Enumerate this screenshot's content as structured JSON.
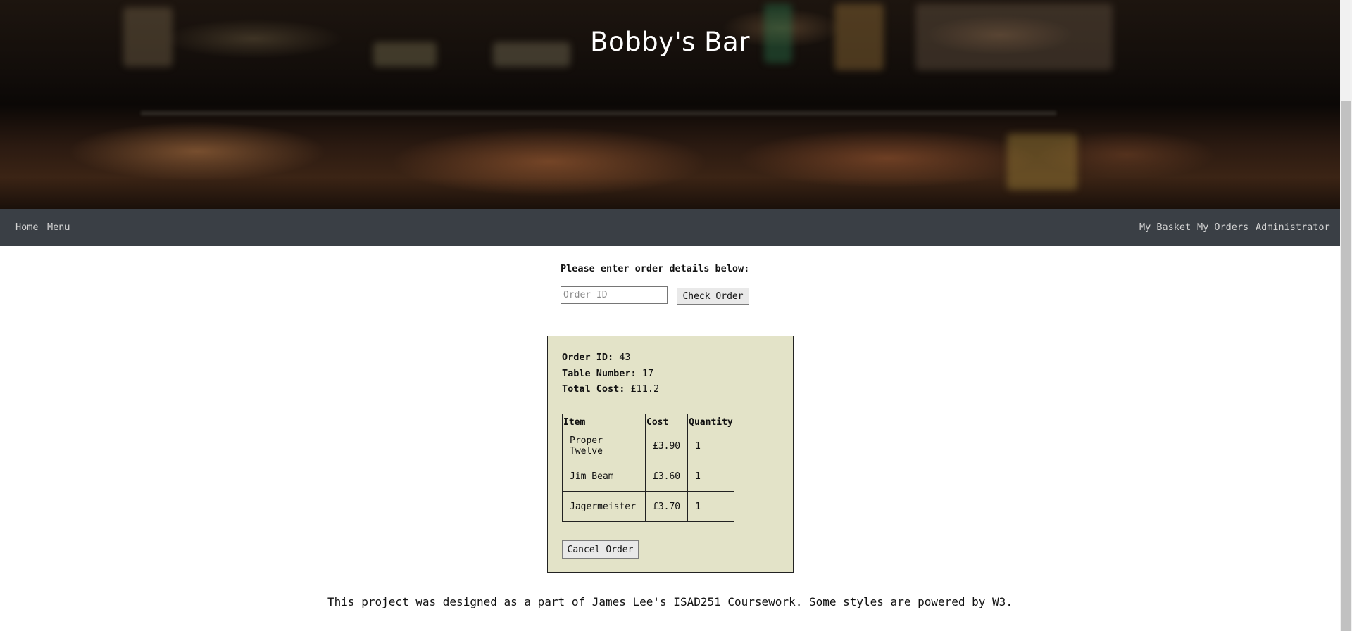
{
  "header": {
    "title": "Bobby's Bar"
  },
  "nav": {
    "left": [
      "Home",
      "Menu"
    ],
    "right": [
      "My Basket",
      "My Orders",
      "Administrator"
    ]
  },
  "form": {
    "prompt": "Please enter order details below:",
    "order_id_placeholder": "Order ID",
    "order_id_value": "",
    "check_button": "Check Order"
  },
  "order": {
    "id_label": "Order ID:",
    "id_value": "43",
    "table_label": "Table Number:",
    "table_value": "17",
    "cost_label": "Total Cost:",
    "cost_value": "£11.2",
    "columns": [
      "Item",
      "Cost",
      "Quantity"
    ],
    "items": [
      {
        "name": "Proper Twelve",
        "cost": "£3.90",
        "quantity": "1"
      },
      {
        "name": "Jim Beam",
        "cost": "£3.60",
        "quantity": "1"
      },
      {
        "name": "Jagermeister",
        "cost": "£3.70",
        "quantity": "1"
      }
    ],
    "cancel_button": "Cancel Order"
  },
  "footer": {
    "text": "This project was designed as a part of James Lee's ISAD251 Coursework. Some styles are powered by W3."
  },
  "colors": {
    "navbar": "#3a3f45",
    "card_background": "#e3e3c8"
  }
}
